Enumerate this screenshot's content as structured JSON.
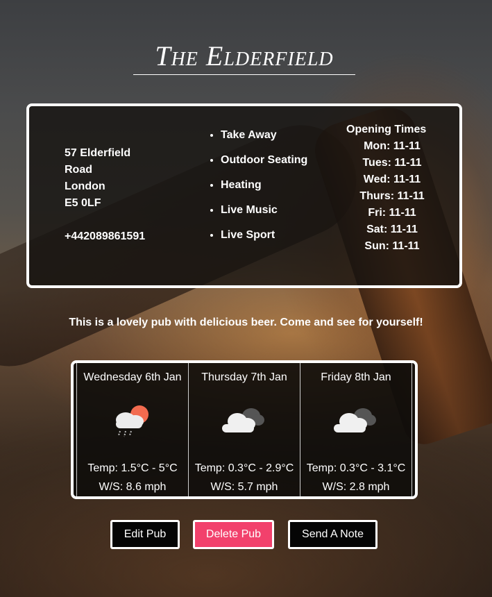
{
  "pub": {
    "name": "The Elderfield",
    "address": [
      "57 Elderfield",
      "Road",
      "London",
      "E5 0LF"
    ],
    "phone": "+442089861591",
    "features": [
      "Take Away",
      "Outdoor Seating",
      "Heating",
      "Live Music",
      "Live Sport"
    ],
    "opening_title": "Opening Times",
    "opening": [
      "Mon: 11-11",
      "Tues: 11-11",
      "Wed: 11-11",
      "Thurs: 11-11",
      "Fri: 11-11",
      "Sat: 11-11",
      "Sun: 11-11"
    ],
    "tagline": "This is a lovely pub with delicious beer. Come and see for yourself!"
  },
  "weather": [
    {
      "date": "Wednesday 6th Jan",
      "icon": "rain-sun-cloud-icon",
      "temp": "Temp: 1.5°C - 5°C",
      "wind": "W/S: 8.6 mph"
    },
    {
      "date": "Thursday 7th Jan",
      "icon": "cloudy-icon",
      "temp": "Temp: 0.3°C - 2.9°C",
      "wind": "W/S: 5.7 mph"
    },
    {
      "date": "Friday 8th Jan",
      "icon": "cloudy-icon",
      "temp": "Temp: 0.3°C - 3.1°C",
      "wind": "W/S: 2.8 mph"
    }
  ],
  "buttons": {
    "edit": "Edit Pub",
    "delete": "Delete Pub",
    "note": "Send A Note"
  },
  "colors": {
    "delete_button": "#f2416c",
    "card_border": "#ffffff"
  }
}
